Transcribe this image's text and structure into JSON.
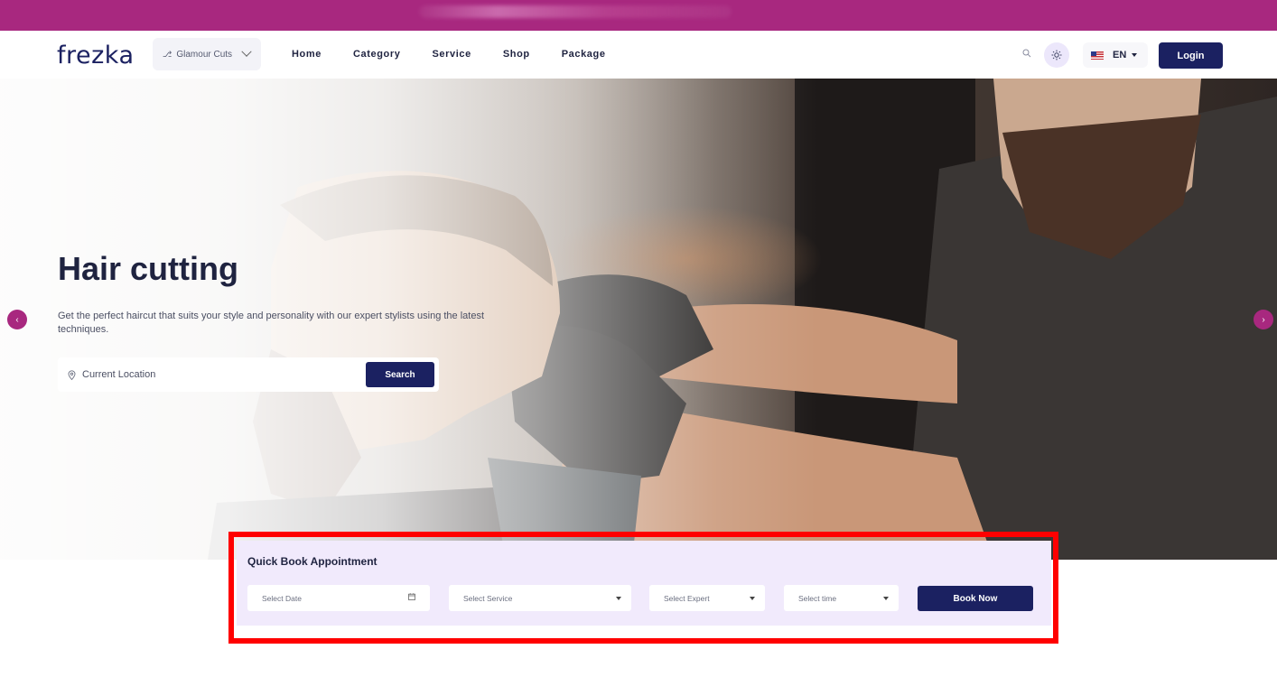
{
  "colors": {
    "brand_primary": "#1b2161",
    "accent": "#a8287f",
    "quickbook_bg": "#f1eafc",
    "highlight_outline": "#ff0000"
  },
  "promo_bar": {
    "icon": "blurred-banner"
  },
  "header": {
    "logo": "frezka",
    "branch_selector": {
      "label": "Glamour Cuts",
      "icon": "branch-icon"
    },
    "nav": [
      "Home",
      "Category",
      "Service",
      "Shop",
      "Package"
    ],
    "icons": [
      "search-icon",
      "sun-icon"
    ],
    "language": {
      "label": "EN",
      "icon": "us-flag-icon"
    },
    "login_label": "Login"
  },
  "hero": {
    "title": "Hair cutting",
    "description": "Get the perfect haircut that suits your style and personality with our expert stylists using the latest techniques.",
    "search": {
      "placeholder": "Current Location",
      "icon": "location-pin-icon",
      "button_label": "Search"
    },
    "prev_icon": "chevron-left-icon",
    "next_icon": "chevron-right-icon"
  },
  "quick_book": {
    "title": "Quick Book Appointment",
    "date_placeholder": "Select Date",
    "service_placeholder": "Select Service",
    "expert_placeholder": "Select Expert",
    "time_placeholder": "Select time",
    "button_label": "Book Now"
  }
}
